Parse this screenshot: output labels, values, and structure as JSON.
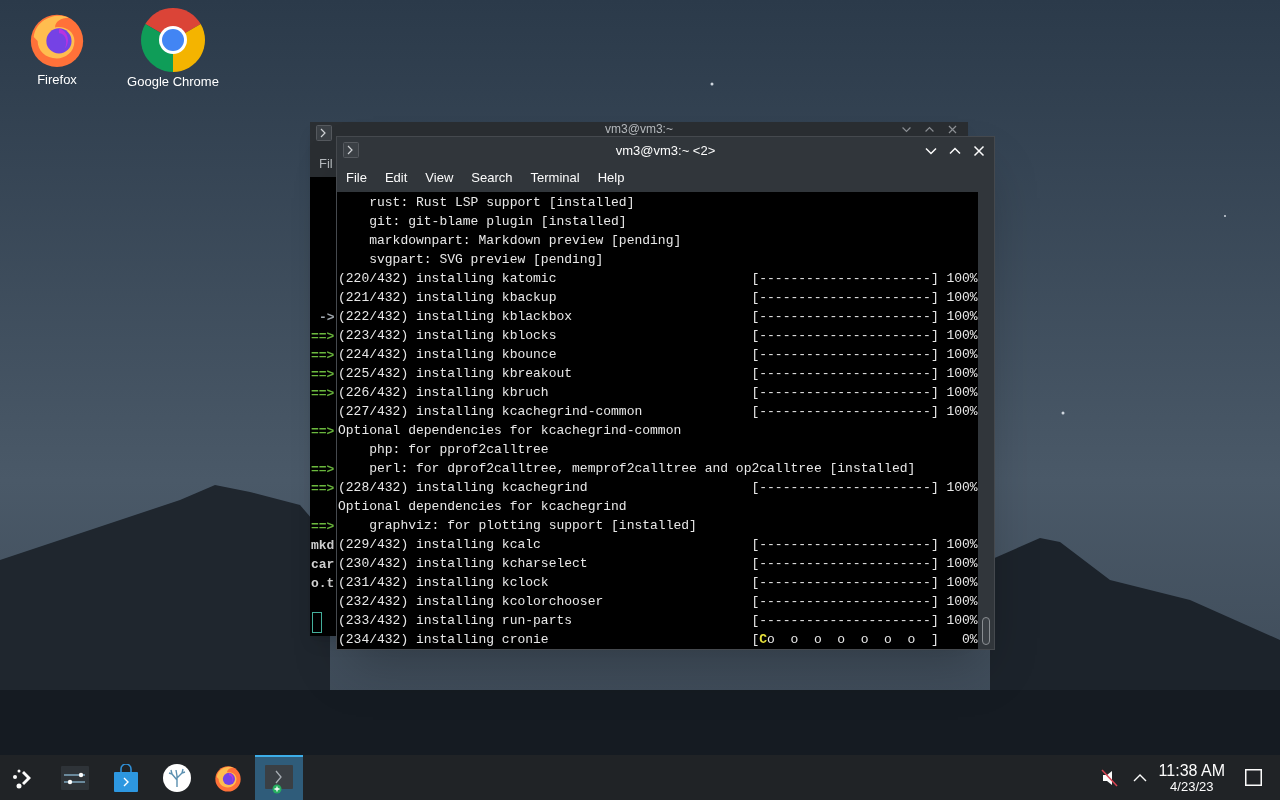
{
  "desktop_icons": [
    {
      "label": "Firefox",
      "kind": "firefox"
    },
    {
      "label": "Google Chrome",
      "kind": "chrome"
    }
  ],
  "back_window": {
    "title": "vm3@vm3:~",
    "menu": [
      "Fil"
    ],
    "lines": [
      {
        "kind": "arrow",
        "text": "->"
      },
      {
        "kind": "marker",
        "text": "==>"
      },
      {
        "kind": "marker",
        "text": "==>"
      },
      {
        "kind": "marker",
        "text": "==>"
      },
      {
        "kind": "marker",
        "text": "==>"
      },
      {
        "kind": "blank"
      },
      {
        "kind": "marker",
        "text": "==>"
      },
      {
        "kind": "blank"
      },
      {
        "kind": "marker",
        "text": "==>"
      },
      {
        "kind": "marker",
        "text": "==>"
      },
      {
        "kind": "blank"
      },
      {
        "kind": "marker",
        "text": "==>"
      },
      {
        "kind": "text",
        "text": "mkd"
      },
      {
        "kind": "text",
        "text": "car"
      },
      {
        "kind": "text",
        "text": "o.t"
      },
      {
        "kind": "blank"
      },
      {
        "kind": "cursor"
      }
    ]
  },
  "window": {
    "title": "vm3@vm3:~ <2>",
    "menu": [
      "File",
      "Edit",
      "View",
      "Search",
      "Terminal",
      "Help"
    ],
    "lines": [
      {
        "kind": "text",
        "text": "    rust: Rust LSP support [installed]"
      },
      {
        "kind": "text",
        "text": "    git: git-blame plugin [installed]"
      },
      {
        "kind": "text",
        "text": "    markdownpart: Markdown preview [pending]"
      },
      {
        "kind": "text",
        "text": "    svgpart: SVG preview [pending]"
      },
      {
        "kind": "progress",
        "text": "(220/432) installing katomic",
        "bar": "[----------------------]",
        "percent": "100%"
      },
      {
        "kind": "progress",
        "text": "(221/432) installing kbackup",
        "bar": "[----------------------]",
        "percent": "100%"
      },
      {
        "kind": "progress",
        "text": "(222/432) installing kblackbox",
        "bar": "[----------------------]",
        "percent": "100%"
      },
      {
        "kind": "progress",
        "text": "(223/432) installing kblocks",
        "bar": "[----------------------]",
        "percent": "100%"
      },
      {
        "kind": "progress",
        "text": "(224/432) installing kbounce",
        "bar": "[----------------------]",
        "percent": "100%"
      },
      {
        "kind": "progress",
        "text": "(225/432) installing kbreakout",
        "bar": "[----------------------]",
        "percent": "100%"
      },
      {
        "kind": "progress",
        "text": "(226/432) installing kbruch",
        "bar": "[----------------------]",
        "percent": "100%"
      },
      {
        "kind": "progress",
        "text": "(227/432) installing kcachegrind-common",
        "bar": "[----------------------]",
        "percent": "100%"
      },
      {
        "kind": "text",
        "text": "Optional dependencies for kcachegrind-common"
      },
      {
        "kind": "text",
        "text": "    php: for pprof2calltree"
      },
      {
        "kind": "text",
        "text": "    perl: for dprof2calltree, memprof2calltree and op2calltree [installed]"
      },
      {
        "kind": "progress",
        "text": "(228/432) installing kcachegrind",
        "bar": "[----------------------]",
        "percent": "100%"
      },
      {
        "kind": "text",
        "text": "Optional dependencies for kcachegrind"
      },
      {
        "kind": "text",
        "text": "    graphviz: for plotting support [installed]"
      },
      {
        "kind": "progress",
        "text": "(229/432) installing kcalc",
        "bar": "[----------------------]",
        "percent": "100%"
      },
      {
        "kind": "progress",
        "text": "(230/432) installing kcharselect",
        "bar": "[----------------------]",
        "percent": "100%"
      },
      {
        "kind": "progress",
        "text": "(231/432) installing kclock",
        "bar": "[----------------------]",
        "percent": "100%"
      },
      {
        "kind": "progress",
        "text": "(232/432) installing kcolorchooser",
        "bar": "[----------------------]",
        "percent": "100%"
      },
      {
        "kind": "progress",
        "text": "(233/432) installing run-parts",
        "bar": "[----------------------]",
        "percent": "100%"
      },
      {
        "kind": "pacman",
        "text": "(234/432) installing cronie",
        "bar_open": "[",
        "cursor": "C",
        "bar": "o  o  o  o  o  o  o  ]",
        "percent": "0%"
      }
    ]
  },
  "taskbar": {
    "items": [
      {
        "kind": "launcher",
        "selected": false
      },
      {
        "kind": "settings",
        "selected": false
      },
      {
        "kind": "store",
        "selected": false
      },
      {
        "kind": "coral",
        "selected": false
      },
      {
        "kind": "firefox",
        "selected": false
      },
      {
        "kind": "konsole",
        "selected": true
      }
    ],
    "time": "11:38 AM",
    "date": "4/23/23"
  }
}
